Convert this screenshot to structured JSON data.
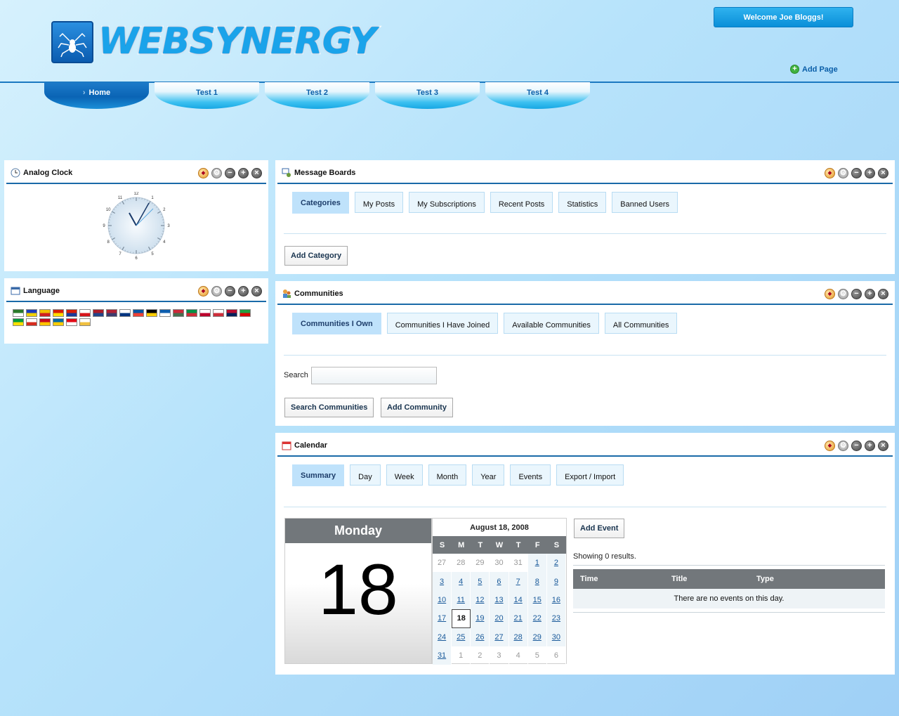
{
  "header": {
    "logo_text": "WEBSYNERGY",
    "welcome": "Welcome Joe Bloggs!",
    "add_page": "Add Page"
  },
  "nav": {
    "items": [
      "Home",
      "Test 1",
      "Test 2",
      "Test 3",
      "Test 4"
    ],
    "active_index": 0
  },
  "clock": {
    "title": "Analog Clock",
    "numbers": [
      "12",
      "1",
      "2",
      "3",
      "4",
      "5",
      "6",
      "7",
      "8",
      "9",
      "10",
      "11"
    ]
  },
  "language": {
    "title": "Language",
    "flags": [
      "ar",
      "ca-ad",
      "ca-es",
      "zh-cn",
      "zh-tw",
      "cs",
      "nl",
      "en-us",
      "fi",
      "fr",
      "de",
      "el",
      "hu",
      "it",
      "ja",
      "ko",
      "nb",
      "fa",
      "pt-br",
      "ru",
      "es",
      "sv",
      "tr",
      "vi"
    ]
  },
  "message_boards": {
    "title": "Message Boards",
    "tabs": [
      "Categories",
      "My Posts",
      "My Subscriptions",
      "Recent Posts",
      "Statistics",
      "Banned Users"
    ],
    "add_category": "Add Category"
  },
  "communities": {
    "title": "Communities",
    "tabs": [
      "Communities I Own",
      "Communities I Have Joined",
      "Available Communities",
      "All Communities"
    ],
    "search_label": "Search",
    "search_value": "",
    "search_button": "Search Communities",
    "add_button": "Add Community"
  },
  "calendar": {
    "title": "Calendar",
    "tabs": [
      "Summary",
      "Day",
      "Week",
      "Month",
      "Year",
      "Events",
      "Export / Import"
    ],
    "day_name": "Monday",
    "day_number": "18",
    "mini_title": "August 18, 2008",
    "weekdays": [
      "S",
      "M",
      "T",
      "W",
      "T",
      "F",
      "S"
    ],
    "days": [
      [
        "27",
        "other"
      ],
      [
        "28",
        "other"
      ],
      [
        "29",
        "other"
      ],
      [
        "30",
        "other"
      ],
      [
        "31",
        "other"
      ],
      [
        "1",
        "cur"
      ],
      [
        "2",
        "cur"
      ],
      [
        "3",
        "cur"
      ],
      [
        "4",
        "cur"
      ],
      [
        "5",
        "cur"
      ],
      [
        "6",
        "cur"
      ],
      [
        "7",
        "cur"
      ],
      [
        "8",
        "cur"
      ],
      [
        "9",
        "cur"
      ],
      [
        "10",
        "cur"
      ],
      [
        "11",
        "cur"
      ],
      [
        "12",
        "cur"
      ],
      [
        "13",
        "cur"
      ],
      [
        "14",
        "cur"
      ],
      [
        "15",
        "cur"
      ],
      [
        "16",
        "cur"
      ],
      [
        "17",
        "cur"
      ],
      [
        "18",
        "today"
      ],
      [
        "19",
        "cur"
      ],
      [
        "20",
        "cur"
      ],
      [
        "21",
        "cur"
      ],
      [
        "22",
        "cur"
      ],
      [
        "23",
        "cur"
      ],
      [
        "24",
        "cur"
      ],
      [
        "25",
        "cur"
      ],
      [
        "26",
        "cur"
      ],
      [
        "27",
        "cur"
      ],
      [
        "28",
        "cur"
      ],
      [
        "29",
        "cur"
      ],
      [
        "30",
        "cur"
      ],
      [
        "31",
        "cur"
      ],
      [
        "1",
        "other"
      ],
      [
        "2",
        "other"
      ],
      [
        "3",
        "other"
      ],
      [
        "4",
        "other"
      ],
      [
        "5",
        "other"
      ],
      [
        "6",
        "other"
      ]
    ],
    "add_event": "Add Event",
    "results": "Showing 0 results.",
    "columns": [
      "Time",
      "Title",
      "Type"
    ],
    "empty": "There are no events on this day."
  }
}
